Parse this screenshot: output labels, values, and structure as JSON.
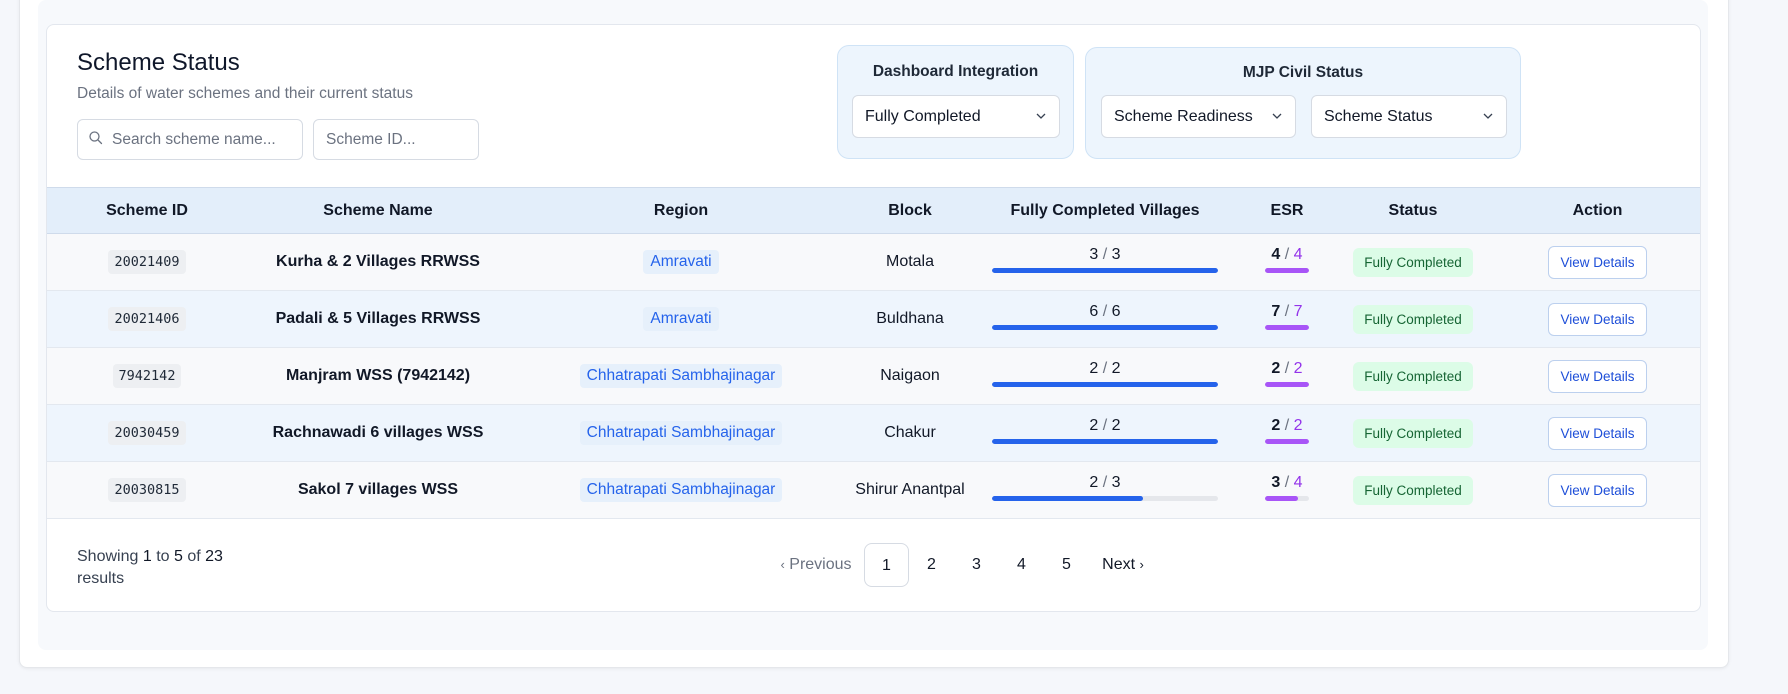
{
  "card": {
    "title": "Scheme Status",
    "subtitle": "Details of water schemes and their current status"
  },
  "search": {
    "placeholder": "Search scheme name..."
  },
  "id_search": {
    "placeholder": "Scheme ID..."
  },
  "dashboard_integration": {
    "title": "Dashboard Integration",
    "selected": "Fully Completed"
  },
  "mjp_civil_status": {
    "title": "MJP Civil Status",
    "readiness": "Scheme Readiness",
    "status": "Scheme Status"
  },
  "table": {
    "headers": [
      "Scheme ID",
      "Scheme Name",
      "Region",
      "Block",
      "Fully Completed Villages",
      "ESR",
      "Status",
      "Action"
    ],
    "rows": [
      {
        "id": "20021409",
        "name": "Kurha & 2 Villages RRWSS",
        "region": "Amravati",
        "block": "Motala",
        "villages_done": "3",
        "villages_total": "3",
        "esr_done": "4",
        "esr_total": "4",
        "status": "Fully Completed",
        "action": "View Details"
      },
      {
        "id": "20021406",
        "name": "Padali & 5 Villages RRWSS",
        "region": "Amravati",
        "block": "Buldhana",
        "villages_done": "6",
        "villages_total": "6",
        "esr_done": "7",
        "esr_total": "7",
        "status": "Fully Completed",
        "action": "View Details"
      },
      {
        "id": "7942142",
        "name": "Manjram WSS (7942142)",
        "region": "Chhatrapati Sambhajinagar",
        "block": "Naigaon",
        "villages_done": "2",
        "villages_total": "2",
        "esr_done": "2",
        "esr_total": "2",
        "status": "Fully Completed",
        "action": "View Details"
      },
      {
        "id": "20030459",
        "name": "Rachnawadi 6 villages WSS",
        "region": "Chhatrapati Sambhajinagar",
        "block": "Chakur",
        "villages_done": "2",
        "villages_total": "2",
        "esr_done": "2",
        "esr_total": "2",
        "status": "Fully Completed",
        "action": "View Details"
      },
      {
        "id": "20030815",
        "name": "Sakol 7 villages WSS",
        "region": "Chhatrapati Sambhajinagar",
        "block": "Shirur Anantpal",
        "villages_done": "2",
        "villages_total": "3",
        "esr_done": "3",
        "esr_total": "4",
        "status": "Fully Completed",
        "action": "View Details"
      }
    ]
  },
  "pagination": {
    "showing_prefix": "Showing",
    "from": "1",
    "to_word": "to",
    "to": "5",
    "of_word": "of",
    "total": "23",
    "results_word": "results",
    "previous": "Previous",
    "pages": [
      "1",
      "2",
      "3",
      "4",
      "5"
    ],
    "current": "1",
    "next": "Next"
  },
  "colors": {
    "accent": "#2563eb",
    "esr": "#a855f7",
    "badge_bg": "#dcfce7",
    "badge_text": "#166534",
    "header_bg": "#e3eefa"
  },
  "icons": {
    "search": "search-icon",
    "dropdown": "chevron-down-icon",
    "prev": "chevron-left-icon",
    "next": "chevron-right-icon"
  }
}
